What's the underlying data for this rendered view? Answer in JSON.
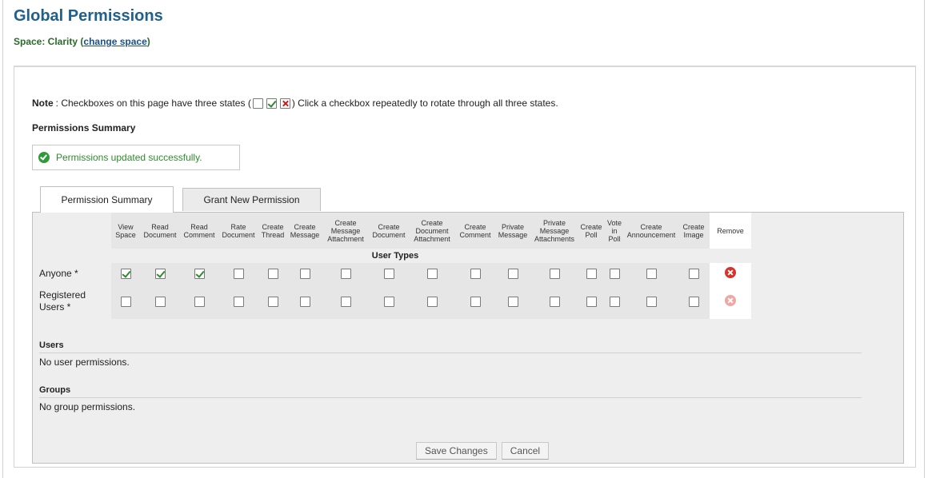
{
  "header": {
    "title": "Global Permissions",
    "space_label": "Space: Clarity",
    "change_space_link": "change space"
  },
  "note": {
    "bold": "Note",
    "text_before": ": Checkboxes on this page have three states (",
    "text_after": ") Click a checkbox repeatedly to rotate through all three states."
  },
  "summary_heading": "Permissions Summary",
  "success_message": "Permissions updated successfully.",
  "tabs": [
    {
      "label": "Permission Summary",
      "active": true
    },
    {
      "label": "Grant New Permission",
      "active": false
    }
  ],
  "columns": [
    [
      "View",
      "Space"
    ],
    [
      "Read",
      "Document"
    ],
    [
      "Read",
      "Comment"
    ],
    [
      "Rate",
      "Document"
    ],
    [
      "Create",
      "Thread"
    ],
    [
      "Create",
      "Message"
    ],
    [
      "Create",
      "Message",
      "Attachment"
    ],
    [
      "Create",
      "Document"
    ],
    [
      "Create",
      "Document",
      "Attachment"
    ],
    [
      "Create",
      "Comment"
    ],
    [
      "Private",
      "Message"
    ],
    [
      "Private",
      "Message",
      "Attachments"
    ],
    [
      "Create",
      "Poll"
    ],
    [
      "Vote",
      "in",
      "Poll"
    ],
    [
      "Create",
      "Announcement"
    ],
    [
      "Create",
      "Image"
    ]
  ],
  "remove_header": "Remove",
  "user_types_label": "User Types",
  "rows": [
    {
      "label": "Anyone *",
      "states": [
        "checked",
        "checked",
        "checked",
        "empty",
        "empty",
        "empty",
        "empty",
        "empty",
        "empty",
        "empty",
        "empty",
        "empty",
        "empty",
        "empty",
        "empty",
        "empty"
      ],
      "remove_enabled": true
    },
    {
      "label": "Registered Users *",
      "states": [
        "empty",
        "empty",
        "empty",
        "empty",
        "empty",
        "empty",
        "empty",
        "empty",
        "empty",
        "empty",
        "empty",
        "empty",
        "empty",
        "empty",
        "empty",
        "empty"
      ],
      "remove_enabled": false
    }
  ],
  "users": {
    "heading": "Users",
    "empty_text": "No user permissions."
  },
  "groups": {
    "heading": "Groups",
    "empty_text": "No group permissions."
  },
  "buttons": {
    "save": "Save Changes",
    "cancel": "Cancel"
  },
  "colors": {
    "title": "#20608a",
    "success": "#2e8b2e",
    "remove": "#d6332a",
    "denied": "#c81c1c"
  }
}
